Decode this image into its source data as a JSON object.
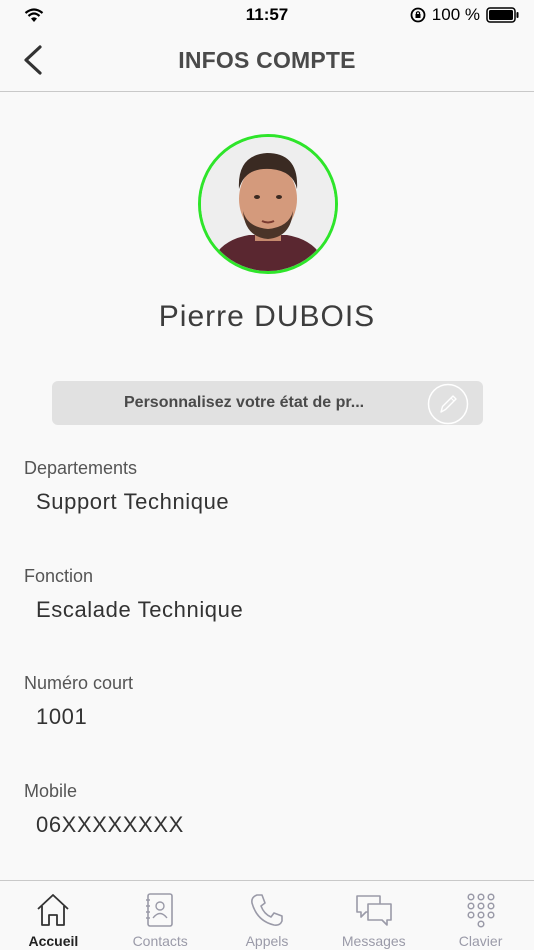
{
  "status_bar": {
    "time": "11:57",
    "battery_percent": "100 %"
  },
  "nav": {
    "title": "INFOS COMPTE"
  },
  "profile": {
    "name": "Pierre DUBOIS",
    "status_placeholder": "Personnalisez votre état de pr..."
  },
  "fields": [
    {
      "label": "Departements",
      "value": "Support Technique"
    },
    {
      "label": "Fonction",
      "value": "Escalade Technique"
    },
    {
      "label": "Numéro court",
      "value": "1001"
    },
    {
      "label": "Mobile",
      "value": "06XXXXXXXX"
    }
  ],
  "tabs": [
    {
      "label": "Accueil",
      "icon": "home-icon",
      "active": true
    },
    {
      "label": "Contacts",
      "icon": "contacts-book-icon"
    },
    {
      "label": "Appels",
      "icon": "phone-icon"
    },
    {
      "label": "Messages",
      "icon": "chat-bubbles-icon"
    },
    {
      "label": "Clavier",
      "icon": "keypad-icon"
    }
  ],
  "colors": {
    "avatar_ring": "#2ee52a",
    "tab_inactive": "#9a9aa8"
  }
}
